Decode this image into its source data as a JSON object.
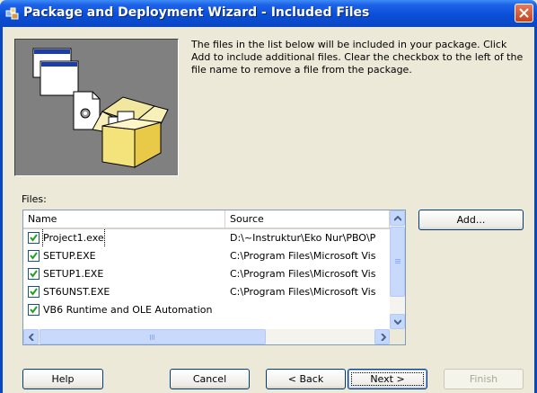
{
  "window": {
    "title": "Package and Deployment Wizard - Included Files",
    "icon": "package-wizard-icon",
    "close_icon": "close-icon"
  },
  "description": "The files in the list below will be included in your package. Click Add to include additional files. Clear the checkbox to the left of the file name to remove a file from the package.",
  "files_label": "Files:",
  "list": {
    "columns": [
      "Name",
      "Source"
    ],
    "rows": [
      {
        "checked": true,
        "name": "Project1.exe",
        "source": "D:\\~Instruktur\\Eko Nur\\PBO\\P"
      },
      {
        "checked": true,
        "name": "SETUP.EXE",
        "source": "C:\\Program Files\\Microsoft Vis"
      },
      {
        "checked": true,
        "name": "SETUP1.EXE",
        "source": "C:\\Program Files\\Microsoft Vis"
      },
      {
        "checked": true,
        "name": "ST6UNST.EXE",
        "source": "C:\\Program Files\\Microsoft Vis"
      },
      {
        "checked": true,
        "name": "VB6 Runtime and OLE Automation",
        "source": ""
      }
    ]
  },
  "buttons": {
    "add": "Add...",
    "help": "Help",
    "cancel": "Cancel",
    "back": "< Back",
    "next": "Next >",
    "finish": "Finish"
  },
  "colors": {
    "titlebar": "#0b46c3",
    "dialog_bg": "#ece9d8",
    "close_button": "#c6431e"
  }
}
